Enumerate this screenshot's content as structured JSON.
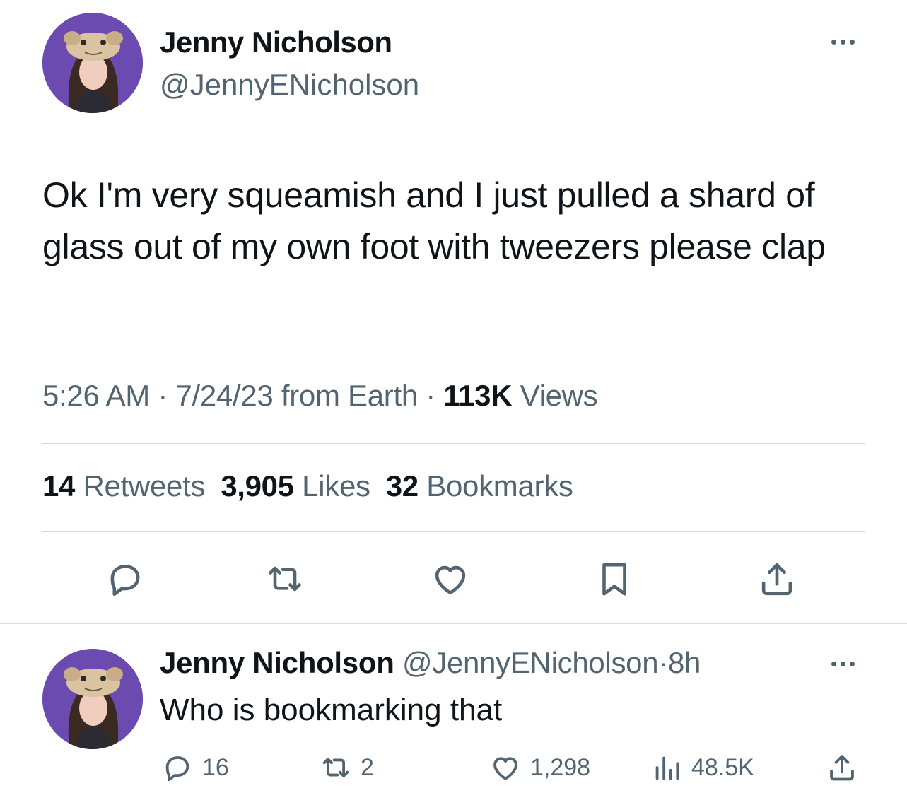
{
  "tweet": {
    "author_name": "Jenny Nicholson",
    "author_handle": "@JennyENicholson",
    "text": "Ok I'm very squeamish and I just pulled a shard of glass out of my own foot with tweezers please clap",
    "time": "5:26 AM",
    "sep1": "·",
    "date": "7/24/23",
    "source": "from Earth",
    "sep2": "·",
    "views_count": "113K",
    "views_label": "Views",
    "retweets_count": "14",
    "retweets_label": "Retweets",
    "likes_count": "3,905",
    "likes_label": "Likes",
    "bookmarks_count": "32",
    "bookmarks_label": "Bookmarks",
    "actions": [
      "reply-icon",
      "retweet-icon",
      "like-icon",
      "bookmark-icon",
      "share-icon"
    ]
  },
  "reply": {
    "author_name": "Jenny Nicholson",
    "author_handle": "@JennyENicholson",
    "sep": "·",
    "age": "8h",
    "text": "Who is bookmarking that",
    "replies": "16",
    "retweets": "2",
    "likes": "1,298",
    "views": "48.5K"
  },
  "colors": {
    "text": "#0f1419",
    "secondary": "#536471",
    "divider": "#d6dbdf",
    "avatar_bg": "#6b4bb0"
  }
}
